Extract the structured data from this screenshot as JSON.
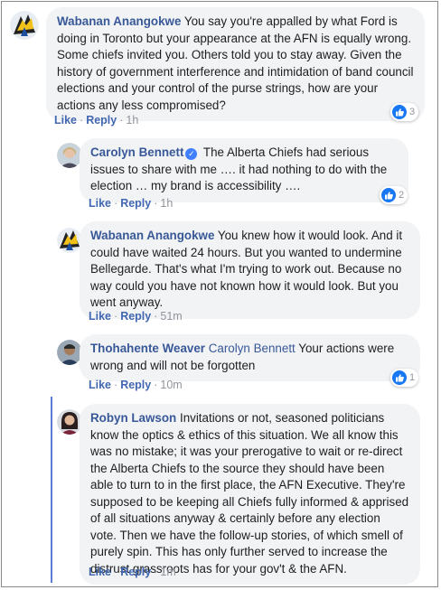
{
  "comments": [
    {
      "author": "Wabanan Anangokwe",
      "text": "You say you're appalled by what Ford is doing in Toronto but your appearance at the AFN is equally wrong. Some chiefs invited you. Others told you to stay away. Given the history of government interference and intimidation of band council elections and your control of the purse strings, how are your actions any less compromised?",
      "like": "Like",
      "reply": "Reply",
      "time": "1h",
      "reactions": "3"
    },
    {
      "author": "Carolyn Bennett",
      "verified": true,
      "text": "The Alberta Chiefs had serious issues to share with me …. it had nothing to do with the election … my brand is accessibility ….",
      "like": "Like",
      "reply": "Reply",
      "time": "1h",
      "reactions": "2"
    },
    {
      "author": "Wabanan Anangokwe",
      "text": "You knew how it would look. And it could have waited 24 hours. But you wanted to undermine Bellegarde. That's what I'm trying to work out. Because no way could you have not known how it would look. But you went anyway.",
      "like": "Like",
      "reply": "Reply",
      "time": "51m"
    },
    {
      "author": "Thohahente Weaver",
      "mention": "Carolyn Bennett",
      "text": "Your actions were wrong and will not be forgotten",
      "like": "Like",
      "reply": "Reply",
      "time": "10m",
      "reactions": "1"
    },
    {
      "author": "Robyn Lawson",
      "text": "Invitations or not, seasoned politicians know the optics & ethics of this situation. We all know this was no mistake; it was your prerogative to wait or re-direct the Alberta Chiefs to the source they should have been able to turn to in the first place, the AFN Executive. They're supposed to be keeping all Chiefs fully informed & apprised of all situations anyway & certainly before any election vote. Then we have the follow-up stories, of which smell of purely spin. This has only further served to increase the distrust grassroots has for your gov't & the AFN.",
      "like": "Like",
      "reply": "Reply",
      "time": "1m"
    }
  ],
  "separator": "·",
  "colors": {
    "author_link": "#385898",
    "action_link": "#4267b2",
    "bubble_bg": "#f2f3f5",
    "like_blue": "#1877f2",
    "thread_line": "#5b7bd5"
  },
  "icons": [
    "thumbs-up-icon",
    "verified-badge-icon"
  ]
}
